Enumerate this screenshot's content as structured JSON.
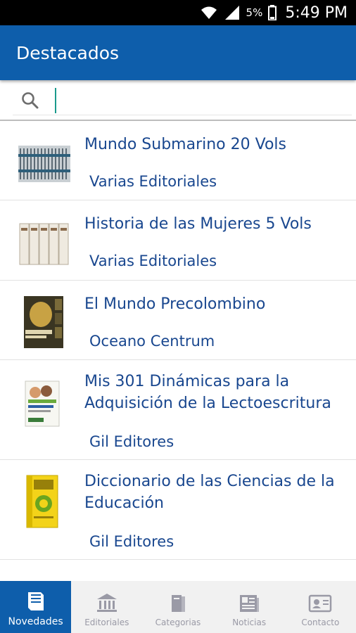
{
  "status_bar": {
    "battery": "5%",
    "time": "5:49 PM"
  },
  "app_bar": {
    "title": "Destacados"
  },
  "search": {
    "placeholder": ""
  },
  "items": [
    {
      "title": "Mundo Submarino 20 Vols",
      "publisher": "Varias Editoriales"
    },
    {
      "title": "Historia de las Mujeres 5 Vols",
      "publisher": "Varias Editoriales"
    },
    {
      "title": "El Mundo Precolombino",
      "publisher": "Oceano Centrum"
    },
    {
      "title": "Mis 301 Dinámicas para la Adquisición de la Lectoescritura",
      "publisher": "Gil Editores"
    },
    {
      "title": "Diccionario de las Ciencias de la Educación",
      "publisher": "Gil Editores"
    }
  ],
  "bottom_nav": [
    {
      "label": "Novedades",
      "icon": "book-icon",
      "active": true
    },
    {
      "label": "Editoriales",
      "icon": "institution-icon",
      "active": false
    },
    {
      "label": "Categorias",
      "icon": "books-icon",
      "active": false
    },
    {
      "label": "Noticias",
      "icon": "newspaper-icon",
      "active": false
    },
    {
      "label": "Contacto",
      "icon": "contact-card-icon",
      "active": false
    }
  ],
  "colors": {
    "primary": "#0e5eab",
    "text_link": "#19478f",
    "nav_inactive": "#9a9aa6"
  }
}
